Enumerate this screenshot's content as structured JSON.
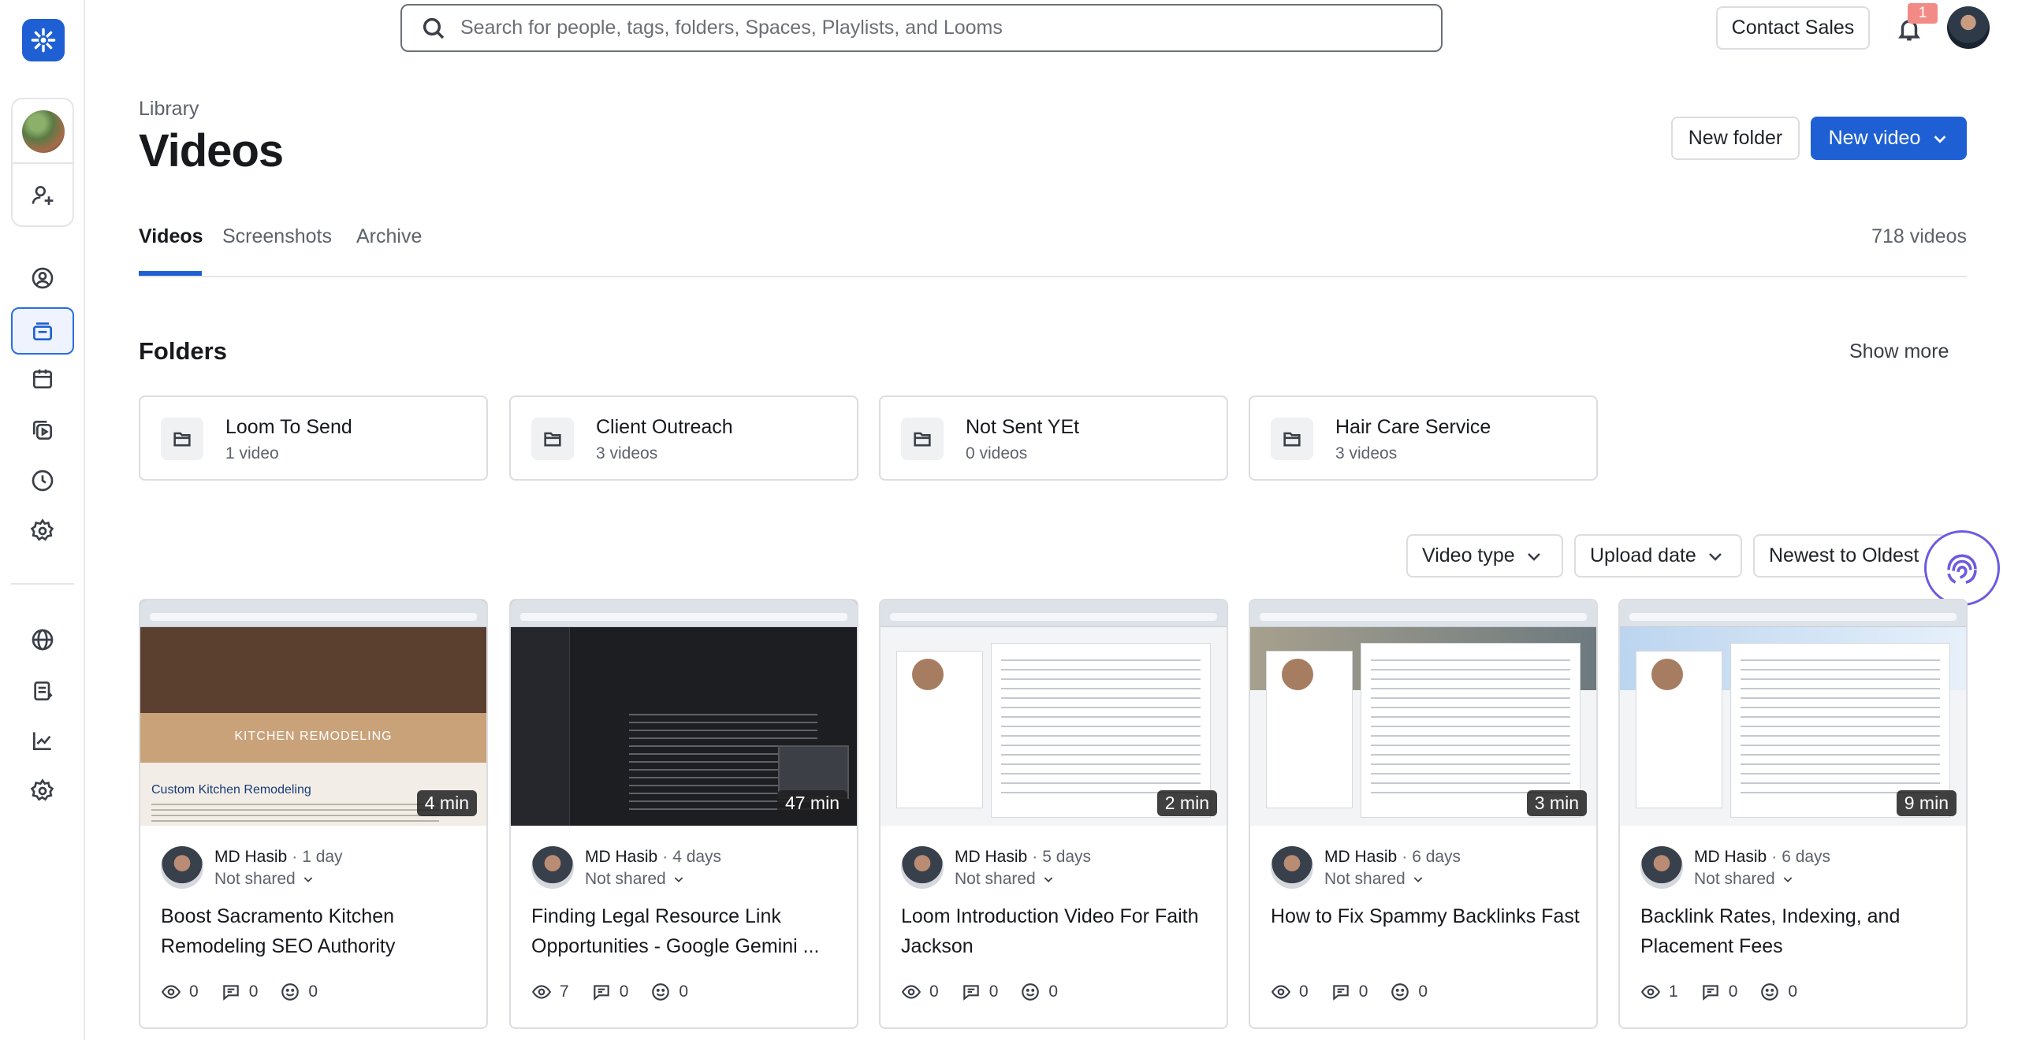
{
  "search": {
    "placeholder": "Search for people, tags, folders, Spaces, Playlists, and Looms"
  },
  "topbar": {
    "contact_label": "Contact Sales",
    "notification_count": "1"
  },
  "header": {
    "breadcrumb": "Library",
    "title": "Videos",
    "new_folder_label": "New folder",
    "new_video_label": "New video"
  },
  "tabs": [
    {
      "label": "Videos"
    },
    {
      "label": "Screenshots"
    },
    {
      "label": "Archive"
    }
  ],
  "video_count": "718 videos",
  "folders_section": {
    "title": "Folders",
    "show_more": "Show more"
  },
  "folders": [
    {
      "name": "Loom To Send",
      "count": "1 video"
    },
    {
      "name": "Client Outreach",
      "count": "3 videos"
    },
    {
      "name": "Not Sent YEt",
      "count": "0 videos"
    },
    {
      "name": "Hair Care Service",
      "count": "3 videos"
    }
  ],
  "filters": {
    "type": "Video type",
    "date": "Upload date",
    "sort": "Newest to Oldest"
  },
  "thumb_text": {
    "hero": "KITCHEN REMODELING",
    "subtitle": "Custom Kitchen Remodeling"
  },
  "videos": [
    {
      "author": "MD Hasib",
      "age": "1 day",
      "share": "Not shared",
      "title": "Boost Sacramento Kitchen Remodeling SEO Authority",
      "duration": "4 min",
      "views": "0",
      "comments": "0",
      "reactions": "0"
    },
    {
      "author": "MD Hasib",
      "age": "4 days",
      "share": "Not shared",
      "title": "Finding Legal Resource Link Opportunities - Google Gemini ...",
      "duration": "47 min",
      "views": "7",
      "comments": "0",
      "reactions": "0"
    },
    {
      "author": "MD Hasib",
      "age": "5 days",
      "share": "Not shared",
      "title": "Loom Introduction Video For Faith Jackson",
      "duration": "2 min",
      "views": "0",
      "comments": "0",
      "reactions": "0"
    },
    {
      "author": "MD Hasib",
      "age": "6 days",
      "share": "Not shared",
      "title": "How to Fix Spammy Backlinks Fast",
      "duration": "3 min",
      "views": "0",
      "comments": "0",
      "reactions": "0"
    },
    {
      "author": "MD Hasib",
      "age": "6 days",
      "share": "Not shared",
      "title": "Backlink Rates, Indexing, and Placement Fees",
      "duration": "9 min",
      "views": "1",
      "comments": "0",
      "reactions": "0"
    }
  ],
  "colors": {
    "accent": "#1e60d4",
    "assistant": "#6b5ce0",
    "badge": "#f28b85"
  }
}
